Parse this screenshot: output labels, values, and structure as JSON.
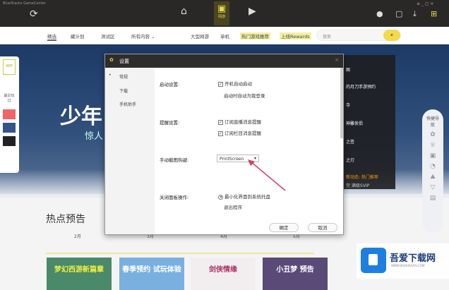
{
  "window": {
    "title": "BlueStacks GameCenter"
  },
  "topbar": {
    "tabs": [
      {
        "icon": "home-icon"
      },
      {
        "icon": "shop-icon",
        "label": "网游",
        "active": true
      },
      {
        "icon": "video-icon"
      }
    ],
    "accent": "#e8d84a"
  },
  "nav": {
    "items": [
      "精选",
      "藏计划",
      "测试区",
      "所有内容 ⌄",
      "大型网游",
      "单机",
      "热门游戏推荐",
      "上线Rewards"
    ],
    "search_placeholder": "搜索"
  },
  "banner": {
    "title": "少年",
    "subtitle": "惊人",
    "right_list": [
      "图",
      "的月刀手游预约",
      "寺",
      "神雕侠侣",
      "之签",
      "之刃",
      "新动态: 热门推荐",
      "完 满级SVIP"
    ]
  },
  "left_bar": [
    "APP",
    "最近玩过"
  ],
  "quick_nav": {
    "label": "快捷导航"
  },
  "hot": {
    "title": "热点预告",
    "months": [
      "2月",
      "3月",
      "4月",
      "5月"
    ]
  },
  "cards": [
    "梦幻西游新篇章",
    "春季预约 试玩体验",
    "剑侠情缘",
    "小丑梦 预告"
  ],
  "dialog": {
    "title": "设置",
    "side": [
      "常规",
      "下载",
      "手机助手"
    ],
    "startup": {
      "label": "启动设置:",
      "opts": [
        "开机自动启动",
        "启动时自动为我登录"
      ]
    },
    "notify": {
      "label": "提醒设置:",
      "opts": [
        "订阅直播消息提醒",
        "订阅栏目消息提醒"
      ]
    },
    "hotkey": {
      "label": "手动截图热键:",
      "value": "PrintScreen"
    },
    "close": {
      "label": "关闭面板操作:",
      "opts": [
        "最小化界面到系统托盘",
        "退出程序"
      ]
    },
    "ok": "确定",
    "cancel": "取消"
  },
  "watermark": {
    "name": "吾爱下载网",
    "url": "WWW.WUAIXIAZAI.COM"
  }
}
